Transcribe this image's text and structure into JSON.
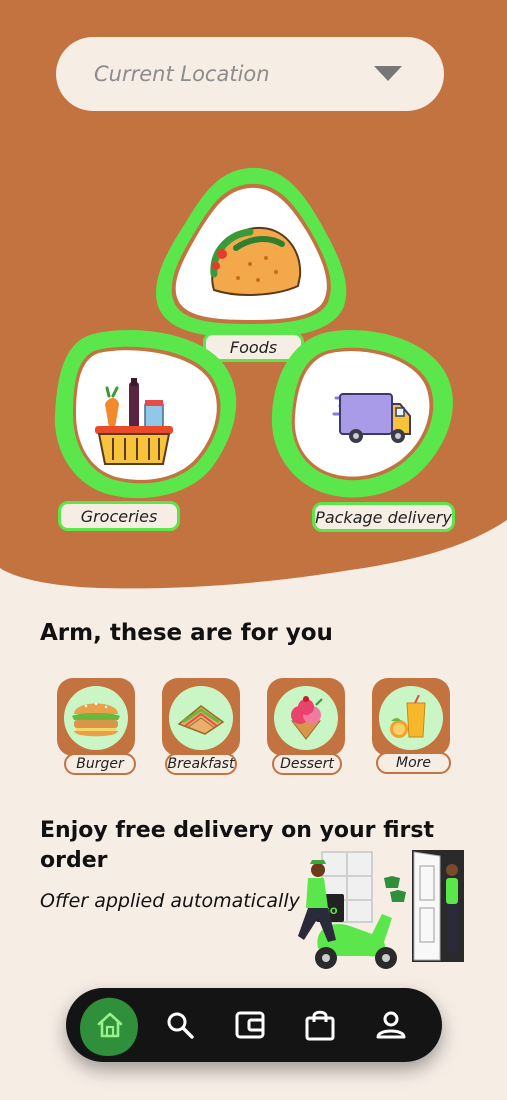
{
  "location": {
    "label": "Current Location",
    "dropdown_icon": "caret-down-icon"
  },
  "services": [
    {
      "label": "Foods",
      "icon": "taco-icon"
    },
    {
      "label": "Groceries",
      "icon": "grocery-basket-icon"
    },
    {
      "label": "Package delivery",
      "icon": "delivery-truck-icon"
    }
  ],
  "recommendations": {
    "title": "Arm, these are for you",
    "items": [
      {
        "label": "Burger",
        "icon": "burger-icon"
      },
      {
        "label": "Breakfast",
        "icon": "sandwich-icon"
      },
      {
        "label": "Dessert",
        "icon": "ice-cream-icon"
      },
      {
        "label": "More",
        "icon": "juice-icon"
      }
    ]
  },
  "promo": {
    "title": "Enjoy free delivery on your first order",
    "subtitle": "Offer applied automatically",
    "scooter_text": "GO"
  },
  "nav": [
    {
      "icon": "home-icon",
      "active": true
    },
    {
      "icon": "search-icon"
    },
    {
      "icon": "wallet-icon"
    },
    {
      "icon": "shopping-bag-icon"
    },
    {
      "icon": "profile-icon"
    }
  ],
  "colors": {
    "hero_brown": "#c27340",
    "cream": "#f6ede5",
    "accent_green": "#5be64b",
    "soft_green": "#caf6c6",
    "nav_dark": "#141414"
  }
}
